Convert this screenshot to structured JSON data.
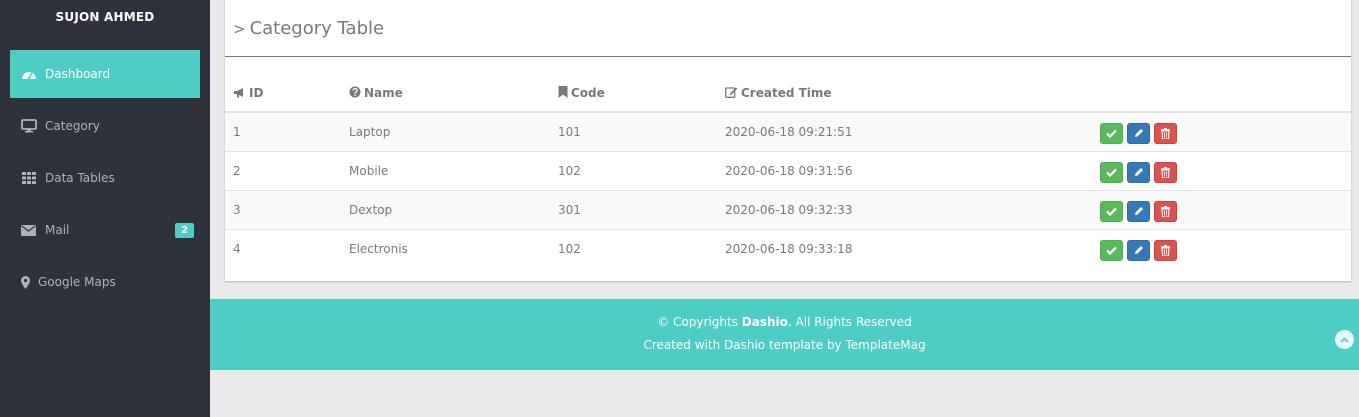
{
  "user": {
    "name": "SUJON AHMED"
  },
  "sidebar": {
    "items": [
      {
        "label": "Dashboard",
        "icon": "dashboard-icon",
        "active": true
      },
      {
        "label": "Category",
        "icon": "desktop-icon"
      },
      {
        "label": "Data Tables",
        "icon": "grid-icon"
      },
      {
        "label": "Mail",
        "icon": "envelope-icon",
        "badge": "2"
      },
      {
        "label": "Google Maps",
        "icon": "map-marker-icon"
      }
    ]
  },
  "panel": {
    "title": "Category Table",
    "columns": [
      {
        "label": "ID",
        "icon": "bullhorn-icon"
      },
      {
        "label": "Name",
        "icon": "question-circle-icon"
      },
      {
        "label": "Code",
        "icon": "bookmark-icon"
      },
      {
        "label": "Created Time",
        "icon": "edit-icon"
      }
    ],
    "rows": [
      {
        "id": "1",
        "name": "Laptop",
        "code": "101",
        "created": "2020-06-18 09:21:51"
      },
      {
        "id": "2",
        "name": "Mobile",
        "code": "102",
        "created": "2020-06-18 09:31:56"
      },
      {
        "id": "3",
        "name": "Dextop",
        "code": "301",
        "created": "2020-06-18 09:32:33"
      },
      {
        "id": "4",
        "name": "Electronis",
        "code": "102",
        "created": "2020-06-18 09:33:18"
      }
    ]
  },
  "footer": {
    "copyright_prefix": "© Copyrights",
    "brand": "Dashio",
    "copyright_suffix": ". All Rights Reserved",
    "credit": "Created with Dashio template by TemplateMag"
  },
  "colors": {
    "accent": "#4ecdc4",
    "sidebar": "#2f323a",
    "success": "#5cb85c",
    "primary": "#337ab7",
    "danger": "#d9534f"
  }
}
